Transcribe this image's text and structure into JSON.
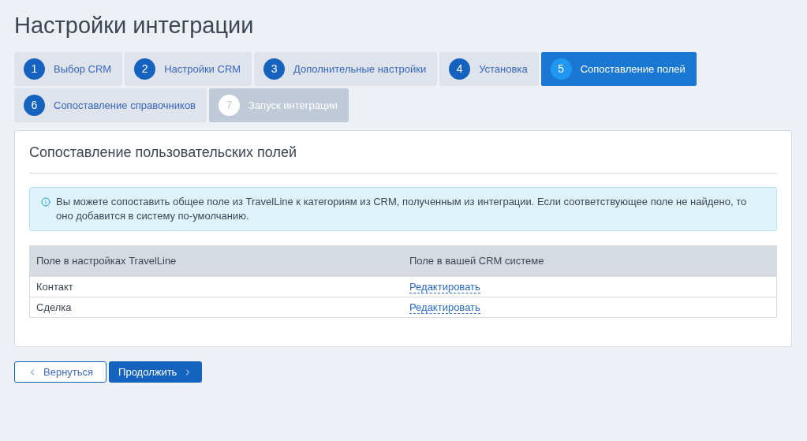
{
  "title": "Настройки интеграции",
  "steps": [
    {
      "number": "1",
      "label": "Выбор CRM",
      "selected": false,
      "disabled": false
    },
    {
      "number": "2",
      "label": "Настройки CRM",
      "selected": false,
      "disabled": false
    },
    {
      "number": "3",
      "label": "Дополнительные настройки",
      "selected": false,
      "disabled": false
    },
    {
      "number": "4",
      "label": "Установка",
      "selected": false,
      "disabled": false
    },
    {
      "number": "5",
      "label": "Сопоставление полей",
      "selected": true,
      "disabled": false
    },
    {
      "number": "6",
      "label": "Сопоставление справочников",
      "selected": false,
      "disabled": false
    },
    {
      "number": "7",
      "label": "Запуск интеграции",
      "selected": false,
      "disabled": true
    }
  ],
  "card": {
    "heading": "Сопоставление пользовательских полей",
    "info": "Вы можете сопоставить общее поле из TravelLine к категориям из CRM, полученным из интеграции. Если соответствующее поле не найдено, то оно добавится в систему по-умолчанию.",
    "table": {
      "columns": [
        "Поле в настройках TravelLine",
        "Поле в вашей CRM системе"
      ],
      "rows": [
        {
          "field": "Контакт",
          "action": "Редактировать"
        },
        {
          "field": "Сделка",
          "action": "Редактировать"
        }
      ]
    }
  },
  "buttons": {
    "back": "Вернуться",
    "next": "Продолжить"
  }
}
